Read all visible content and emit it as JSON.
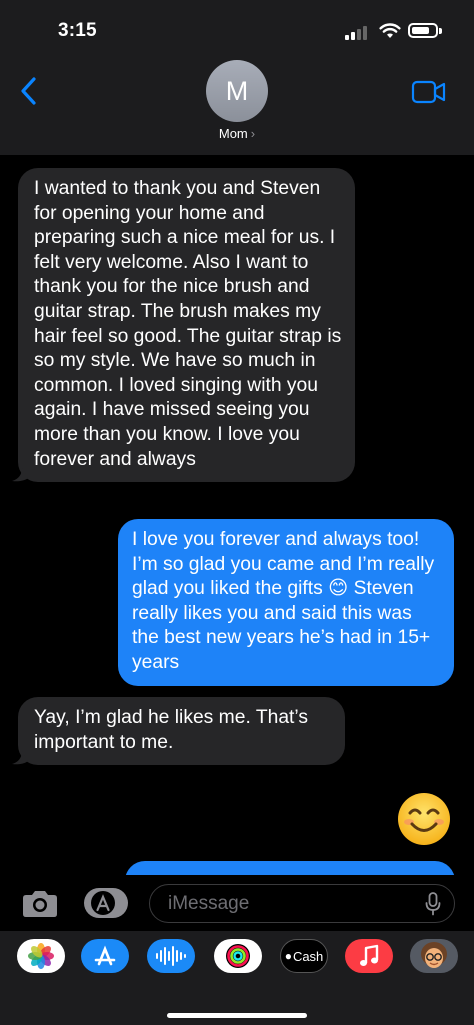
{
  "status_bar": {
    "time": "3:15"
  },
  "header": {
    "avatar_initial": "M",
    "contact_name": "Mom",
    "contact_chevron": "›"
  },
  "messages": [
    {
      "direction": "incoming",
      "text": "I wanted to thank you and Steven for opening your home and preparing such a nice meal for us. I felt very welcome. Also I want to thank you for the nice brush and guitar strap. The brush makes my hair feel so good. The guitar strap is so my style. We have so much in common. I loved singing with you again. I have missed seeing you more than you know. I love you forever and always"
    },
    {
      "direction": "outgoing",
      "text": "I love you forever and always too! I’m so glad you came and I’m really glad you liked the gifts 😊 Steven really likes you and said this was the best new years he’s had in 15+ years"
    },
    {
      "direction": "incoming",
      "text": "Yay, I’m glad he likes me. That’s important to me."
    },
    {
      "direction": "incoming",
      "emoji": "smiling-face-emoji"
    }
  ],
  "input": {
    "placeholder": "iMessage"
  },
  "app_drawer": {
    "cash_label": "Cash"
  },
  "colors": {
    "outgoing_bubble": "#1e83f8",
    "incoming_bubble": "#262628",
    "accent": "#0a84ff"
  }
}
